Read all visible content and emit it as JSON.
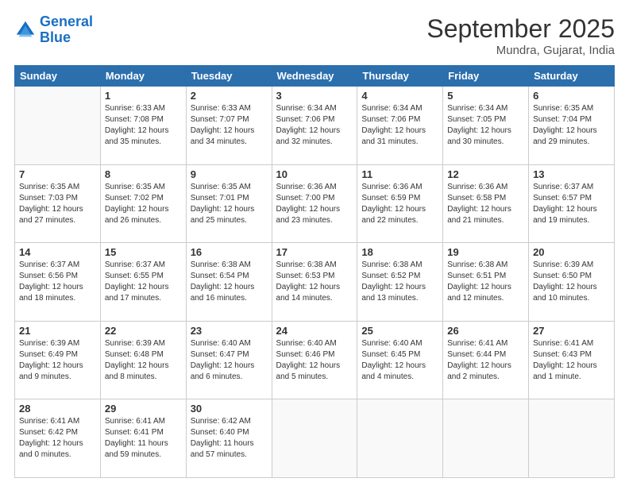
{
  "logo": {
    "line1": "General",
    "line2": "Blue"
  },
  "header": {
    "month": "September 2025",
    "location": "Mundra, Gujarat, India"
  },
  "weekdays": [
    "Sunday",
    "Monday",
    "Tuesday",
    "Wednesday",
    "Thursday",
    "Friday",
    "Saturday"
  ],
  "weeks": [
    [
      {
        "day": "",
        "info": ""
      },
      {
        "day": "1",
        "info": "Sunrise: 6:33 AM\nSunset: 7:08 PM\nDaylight: 12 hours\nand 35 minutes."
      },
      {
        "day": "2",
        "info": "Sunrise: 6:33 AM\nSunset: 7:07 PM\nDaylight: 12 hours\nand 34 minutes."
      },
      {
        "day": "3",
        "info": "Sunrise: 6:34 AM\nSunset: 7:06 PM\nDaylight: 12 hours\nand 32 minutes."
      },
      {
        "day": "4",
        "info": "Sunrise: 6:34 AM\nSunset: 7:06 PM\nDaylight: 12 hours\nand 31 minutes."
      },
      {
        "day": "5",
        "info": "Sunrise: 6:34 AM\nSunset: 7:05 PM\nDaylight: 12 hours\nand 30 minutes."
      },
      {
        "day": "6",
        "info": "Sunrise: 6:35 AM\nSunset: 7:04 PM\nDaylight: 12 hours\nand 29 minutes."
      }
    ],
    [
      {
        "day": "7",
        "info": "Sunrise: 6:35 AM\nSunset: 7:03 PM\nDaylight: 12 hours\nand 27 minutes."
      },
      {
        "day": "8",
        "info": "Sunrise: 6:35 AM\nSunset: 7:02 PM\nDaylight: 12 hours\nand 26 minutes."
      },
      {
        "day": "9",
        "info": "Sunrise: 6:35 AM\nSunset: 7:01 PM\nDaylight: 12 hours\nand 25 minutes."
      },
      {
        "day": "10",
        "info": "Sunrise: 6:36 AM\nSunset: 7:00 PM\nDaylight: 12 hours\nand 23 minutes."
      },
      {
        "day": "11",
        "info": "Sunrise: 6:36 AM\nSunset: 6:59 PM\nDaylight: 12 hours\nand 22 minutes."
      },
      {
        "day": "12",
        "info": "Sunrise: 6:36 AM\nSunset: 6:58 PM\nDaylight: 12 hours\nand 21 minutes."
      },
      {
        "day": "13",
        "info": "Sunrise: 6:37 AM\nSunset: 6:57 PM\nDaylight: 12 hours\nand 19 minutes."
      }
    ],
    [
      {
        "day": "14",
        "info": "Sunrise: 6:37 AM\nSunset: 6:56 PM\nDaylight: 12 hours\nand 18 minutes."
      },
      {
        "day": "15",
        "info": "Sunrise: 6:37 AM\nSunset: 6:55 PM\nDaylight: 12 hours\nand 17 minutes."
      },
      {
        "day": "16",
        "info": "Sunrise: 6:38 AM\nSunset: 6:54 PM\nDaylight: 12 hours\nand 16 minutes."
      },
      {
        "day": "17",
        "info": "Sunrise: 6:38 AM\nSunset: 6:53 PM\nDaylight: 12 hours\nand 14 minutes."
      },
      {
        "day": "18",
        "info": "Sunrise: 6:38 AM\nSunset: 6:52 PM\nDaylight: 12 hours\nand 13 minutes."
      },
      {
        "day": "19",
        "info": "Sunrise: 6:38 AM\nSunset: 6:51 PM\nDaylight: 12 hours\nand 12 minutes."
      },
      {
        "day": "20",
        "info": "Sunrise: 6:39 AM\nSunset: 6:50 PM\nDaylight: 12 hours\nand 10 minutes."
      }
    ],
    [
      {
        "day": "21",
        "info": "Sunrise: 6:39 AM\nSunset: 6:49 PM\nDaylight: 12 hours\nand 9 minutes."
      },
      {
        "day": "22",
        "info": "Sunrise: 6:39 AM\nSunset: 6:48 PM\nDaylight: 12 hours\nand 8 minutes."
      },
      {
        "day": "23",
        "info": "Sunrise: 6:40 AM\nSunset: 6:47 PM\nDaylight: 12 hours\nand 6 minutes."
      },
      {
        "day": "24",
        "info": "Sunrise: 6:40 AM\nSunset: 6:46 PM\nDaylight: 12 hours\nand 5 minutes."
      },
      {
        "day": "25",
        "info": "Sunrise: 6:40 AM\nSunset: 6:45 PM\nDaylight: 12 hours\nand 4 minutes."
      },
      {
        "day": "26",
        "info": "Sunrise: 6:41 AM\nSunset: 6:44 PM\nDaylight: 12 hours\nand 2 minutes."
      },
      {
        "day": "27",
        "info": "Sunrise: 6:41 AM\nSunset: 6:43 PM\nDaylight: 12 hours\nand 1 minute."
      }
    ],
    [
      {
        "day": "28",
        "info": "Sunrise: 6:41 AM\nSunset: 6:42 PM\nDaylight: 12 hours\nand 0 minutes."
      },
      {
        "day": "29",
        "info": "Sunrise: 6:41 AM\nSunset: 6:41 PM\nDaylight: 11 hours\nand 59 minutes."
      },
      {
        "day": "30",
        "info": "Sunrise: 6:42 AM\nSunset: 6:40 PM\nDaylight: 11 hours\nand 57 minutes."
      },
      {
        "day": "",
        "info": ""
      },
      {
        "day": "",
        "info": ""
      },
      {
        "day": "",
        "info": ""
      },
      {
        "day": "",
        "info": ""
      }
    ]
  ]
}
